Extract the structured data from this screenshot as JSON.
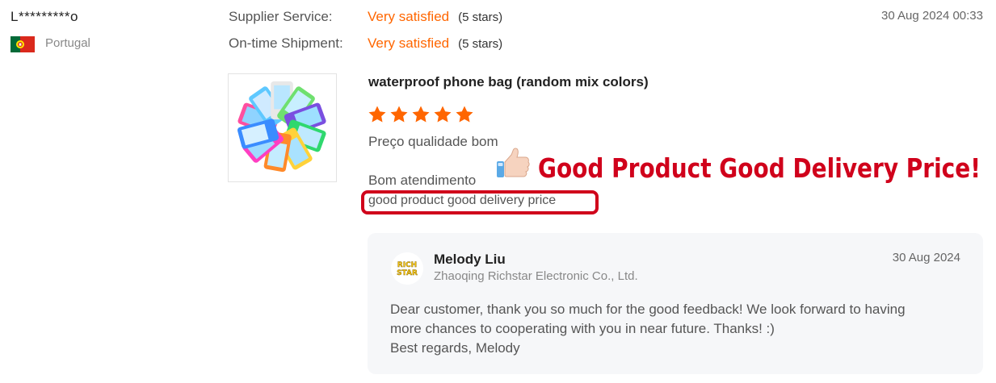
{
  "reviewer": {
    "name": "L*********o",
    "country": "Portugal",
    "flag_icon": "portugal-flag-icon"
  },
  "ratings": [
    {
      "label": "Supplier Service:",
      "value": "Very satisfied",
      "stars": "(5 stars)"
    },
    {
      "label": "On-time Shipment:",
      "value": "Very satisfied",
      "stars": "(5 stars)"
    }
  ],
  "review": {
    "date": "30 Aug 2024 00:33",
    "product_title": "waterproof phone bag (random mix colors)",
    "star_rating": 5,
    "lines": [
      "Preço qualidade bom",
      "Bom atendimento",
      "good product good delivery price"
    ]
  },
  "banner": {
    "text": "Good Product Good Delivery Price!",
    "icon": "thumbs-up-icon"
  },
  "reply": {
    "name": "Melody Liu",
    "company": "Zhaoqing Richstar Electronic Co., Ltd.",
    "date": "30 Aug 2024",
    "avatar_text": [
      "RICH",
      "STAR"
    ],
    "lines": [
      "Dear customer, thank you so much for the good feedback! We look forward to having",
      "more chances to cooperating with you in near future. Thanks! :)",
      "Best regards, Melody"
    ]
  },
  "colors": {
    "accent": "#ff6600",
    "highlight_border": "#d0011b",
    "reply_bg": "#f6f7f9"
  }
}
